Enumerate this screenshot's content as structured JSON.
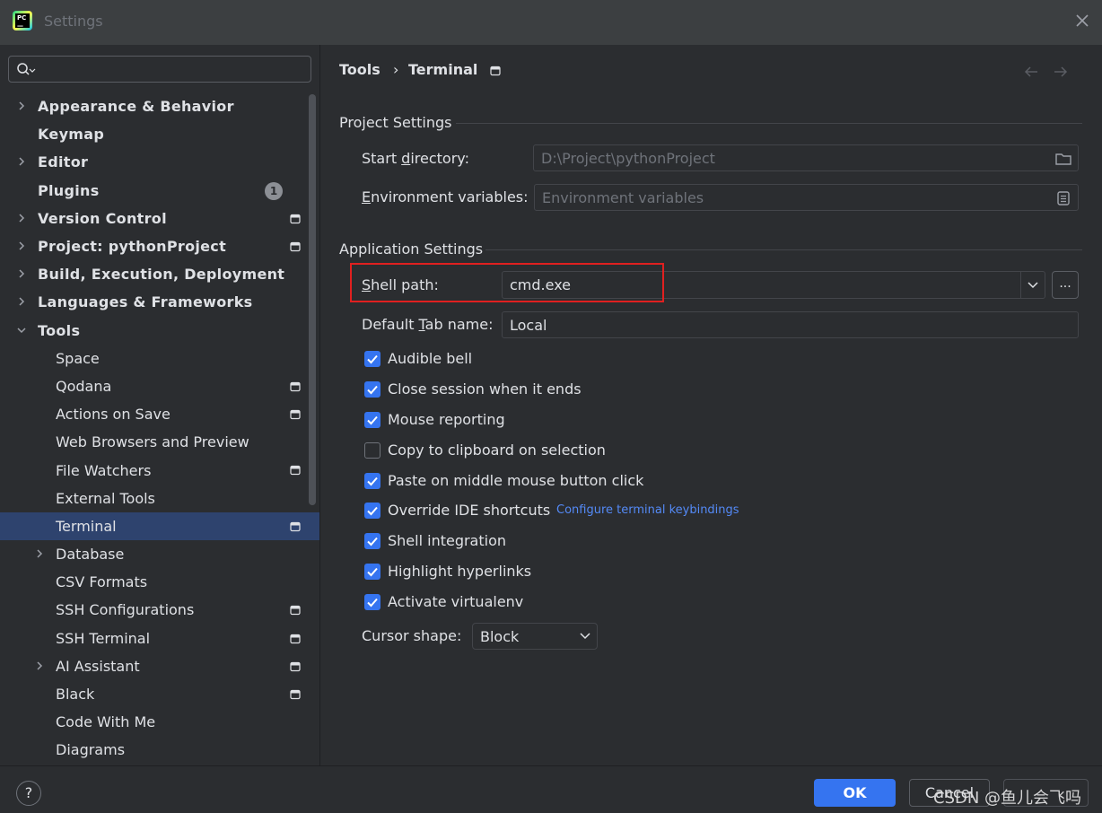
{
  "window": {
    "title": "Settings"
  },
  "search": {
    "placeholder": ""
  },
  "sidebar": {
    "items": [
      {
        "label": "Appearance & Behavior",
        "bold": true,
        "level": 0,
        "chevron": "right",
        "proj": false
      },
      {
        "label": "Keymap",
        "bold": true,
        "level": 0,
        "chevron": "",
        "proj": false
      },
      {
        "label": "Editor",
        "bold": true,
        "level": 0,
        "chevron": "right",
        "proj": false
      },
      {
        "label": "Plugins",
        "bold": true,
        "level": 0,
        "chevron": "",
        "proj": false,
        "badge": "1"
      },
      {
        "label": "Version Control",
        "bold": true,
        "level": 0,
        "chevron": "right",
        "proj": true
      },
      {
        "label": "Project: pythonProject",
        "bold": true,
        "level": 0,
        "chevron": "right",
        "proj": true
      },
      {
        "label": "Build, Execution, Deployment",
        "bold": true,
        "level": 0,
        "chevron": "right",
        "proj": false
      },
      {
        "label": "Languages & Frameworks",
        "bold": true,
        "level": 0,
        "chevron": "right",
        "proj": false
      },
      {
        "label": "Tools",
        "bold": true,
        "level": 0,
        "chevron": "down",
        "proj": false
      },
      {
        "label": "Space",
        "bold": false,
        "level": 1,
        "chevron": "",
        "proj": false
      },
      {
        "label": "Qodana",
        "bold": false,
        "level": 1,
        "chevron": "",
        "proj": true
      },
      {
        "label": "Actions on Save",
        "bold": false,
        "level": 1,
        "chevron": "",
        "proj": true
      },
      {
        "label": "Web Browsers and Preview",
        "bold": false,
        "level": 1,
        "chevron": "",
        "proj": false
      },
      {
        "label": "File Watchers",
        "bold": false,
        "level": 1,
        "chevron": "",
        "proj": true
      },
      {
        "label": "External Tools",
        "bold": false,
        "level": 1,
        "chevron": "",
        "proj": false
      },
      {
        "label": "Terminal",
        "bold": false,
        "level": 1,
        "chevron": "",
        "proj": true,
        "selected": true
      },
      {
        "label": "Database",
        "bold": false,
        "level": 1,
        "chevron": "right",
        "proj": false
      },
      {
        "label": "CSV Formats",
        "bold": false,
        "level": 1,
        "chevron": "",
        "proj": false
      },
      {
        "label": "SSH Configurations",
        "bold": false,
        "level": 1,
        "chevron": "",
        "proj": true
      },
      {
        "label": "SSH Terminal",
        "bold": false,
        "level": 1,
        "chevron": "",
        "proj": true
      },
      {
        "label": "AI Assistant",
        "bold": false,
        "level": 1,
        "chevron": "right",
        "proj": true
      },
      {
        "label": "Black",
        "bold": false,
        "level": 1,
        "chevron": "",
        "proj": true
      },
      {
        "label": "Code With Me",
        "bold": false,
        "level": 1,
        "chevron": "",
        "proj": false
      },
      {
        "label": "Diagrams",
        "bold": false,
        "level": 1,
        "chevron": "",
        "proj": false
      }
    ]
  },
  "breadcrumb": {
    "parent": "Tools",
    "separator": "›",
    "current": "Terminal"
  },
  "project_settings": {
    "title": "Project Settings",
    "start_directory": {
      "label_pre": "Start ",
      "label_u": "d",
      "label_post": "irectory:",
      "value": "D:\\Project\\pythonProject"
    },
    "env_vars": {
      "label_u": "E",
      "label_post": "nvironment variables:",
      "placeholder": "Environment variables"
    }
  },
  "app_settings": {
    "title": "Application Settings",
    "shell_path": {
      "label_u": "S",
      "label_post": "hell path:",
      "value": "cmd.exe"
    },
    "browse_label": "...",
    "default_tab": {
      "label_pre": "Default ",
      "label_u": "T",
      "label_post": "ab name:",
      "value": "Local"
    },
    "checkboxes": [
      {
        "label": "Audible bell",
        "checked": true
      },
      {
        "label": "Close session when it ends",
        "checked": true
      },
      {
        "label": "Mouse reporting",
        "checked": true
      },
      {
        "label": "Copy to clipboard on selection",
        "checked": false
      },
      {
        "label": "Paste on middle mouse button click",
        "checked": true
      },
      {
        "label": "Override IDE shortcuts",
        "checked": true
      },
      {
        "label": "Shell integration",
        "checked": true
      },
      {
        "label": "Highlight hyperlinks",
        "checked": true
      },
      {
        "label": "Activate virtualenv",
        "checked": true
      }
    ],
    "keybindings_link": "Configure terminal keybindings",
    "cursor_shape": {
      "label": "Cursor shape:",
      "value": "Block"
    }
  },
  "footer": {
    "help": "?",
    "ok": "OK",
    "cancel": "Cancel",
    "apply": ""
  },
  "watermark": "CSDN @鱼儿会飞吗",
  "colors": {
    "accent": "#3574f0",
    "selection": "#2e436e",
    "link": "#548af7",
    "highlight_box": "#e02020"
  }
}
